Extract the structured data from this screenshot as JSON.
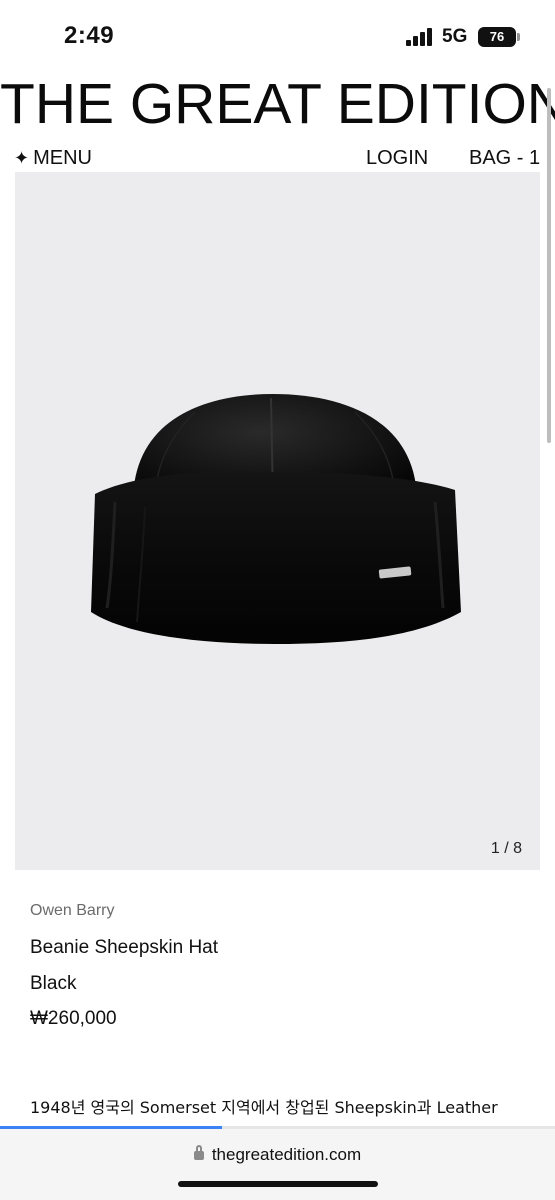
{
  "status": {
    "time": "2:49",
    "network": "5G",
    "battery": "76"
  },
  "header": {
    "brand": "THE GREAT EDITION"
  },
  "nav": {
    "menu_icon": "sparkle-icon",
    "menu_label": "MENU",
    "login_label": "LOGIN",
    "bag_label": "BAG - 1"
  },
  "gallery": {
    "counter": "1 / 8"
  },
  "product": {
    "brand": "Owen Barry",
    "name": "Beanie Sheepskin Hat",
    "color": "Black",
    "price": "₩260,000",
    "description": "1948년 영국의 Somerset 지역에서 창업된 Sheepskin과 Leather"
  },
  "browser": {
    "url": "thegreatedition.com",
    "load_progress": 0.4
  },
  "colors": {
    "accent": "#3b82f6",
    "image_bg": "#ececee"
  }
}
